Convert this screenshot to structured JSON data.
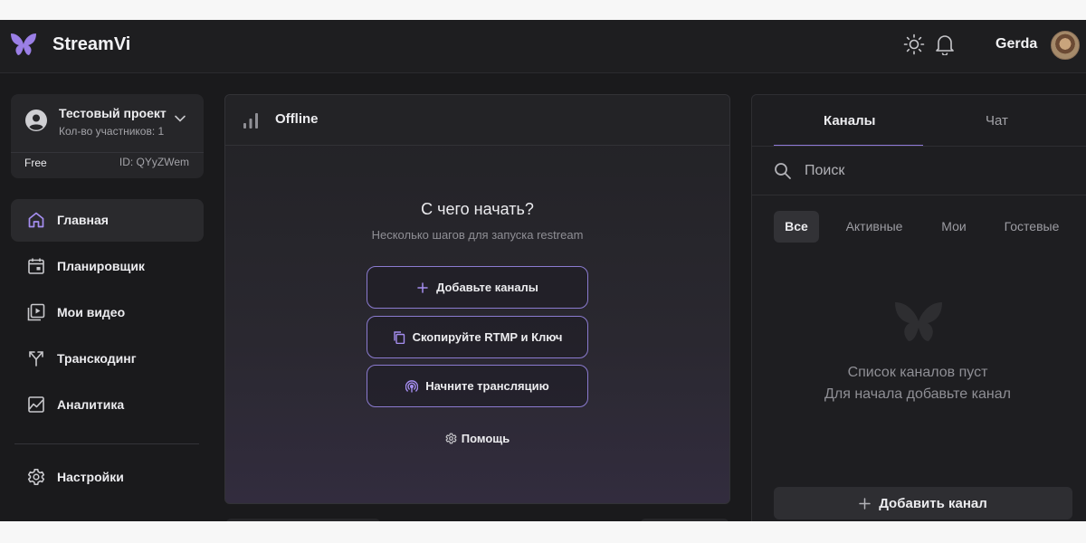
{
  "header": {
    "brand": "StreamVi",
    "username": "Gerda"
  },
  "project": {
    "name": "Тестовый проект",
    "members": "Кол-во участников: 1",
    "plan": "Free",
    "id": "ID: QYyZWem"
  },
  "sidebar": {
    "items": [
      {
        "label": "Главная",
        "icon": "home-icon"
      },
      {
        "label": "Планировщик",
        "icon": "calendar-icon"
      },
      {
        "label": "Мои видео",
        "icon": "video-library-icon"
      },
      {
        "label": "Транскодинг",
        "icon": "fork-icon"
      },
      {
        "label": "Аналитика",
        "icon": "chart-icon"
      }
    ],
    "settings": {
      "label": "Настройки",
      "icon": "gear-icon"
    }
  },
  "stream_panel": {
    "status": "Offline",
    "title": "С чего начать?",
    "subtitle": "Несколько шагов для запуска restream",
    "actions": [
      {
        "label": "Добавьте каналы",
        "icon": "plus-icon"
      },
      {
        "label": "Скопируйте RTMP и Ключ",
        "icon": "copy-icon"
      },
      {
        "label": "Начните трансляцию",
        "icon": "broadcast-icon"
      }
    ],
    "help": "Помощь"
  },
  "channels_panel": {
    "tabs": [
      "Каналы",
      "Чат"
    ],
    "active_tab": 0,
    "search_placeholder": "Поиск",
    "filters": [
      "Все",
      "Активные",
      "Мои",
      "Гостевые"
    ],
    "active_filter": 0,
    "empty_line1": "Список каналов пуст",
    "empty_line2": "Для начала добавьте канал",
    "add_button": "Добавить канал"
  },
  "colors": {
    "accent": "#8f7ad8",
    "background": "#1a1a1c"
  }
}
